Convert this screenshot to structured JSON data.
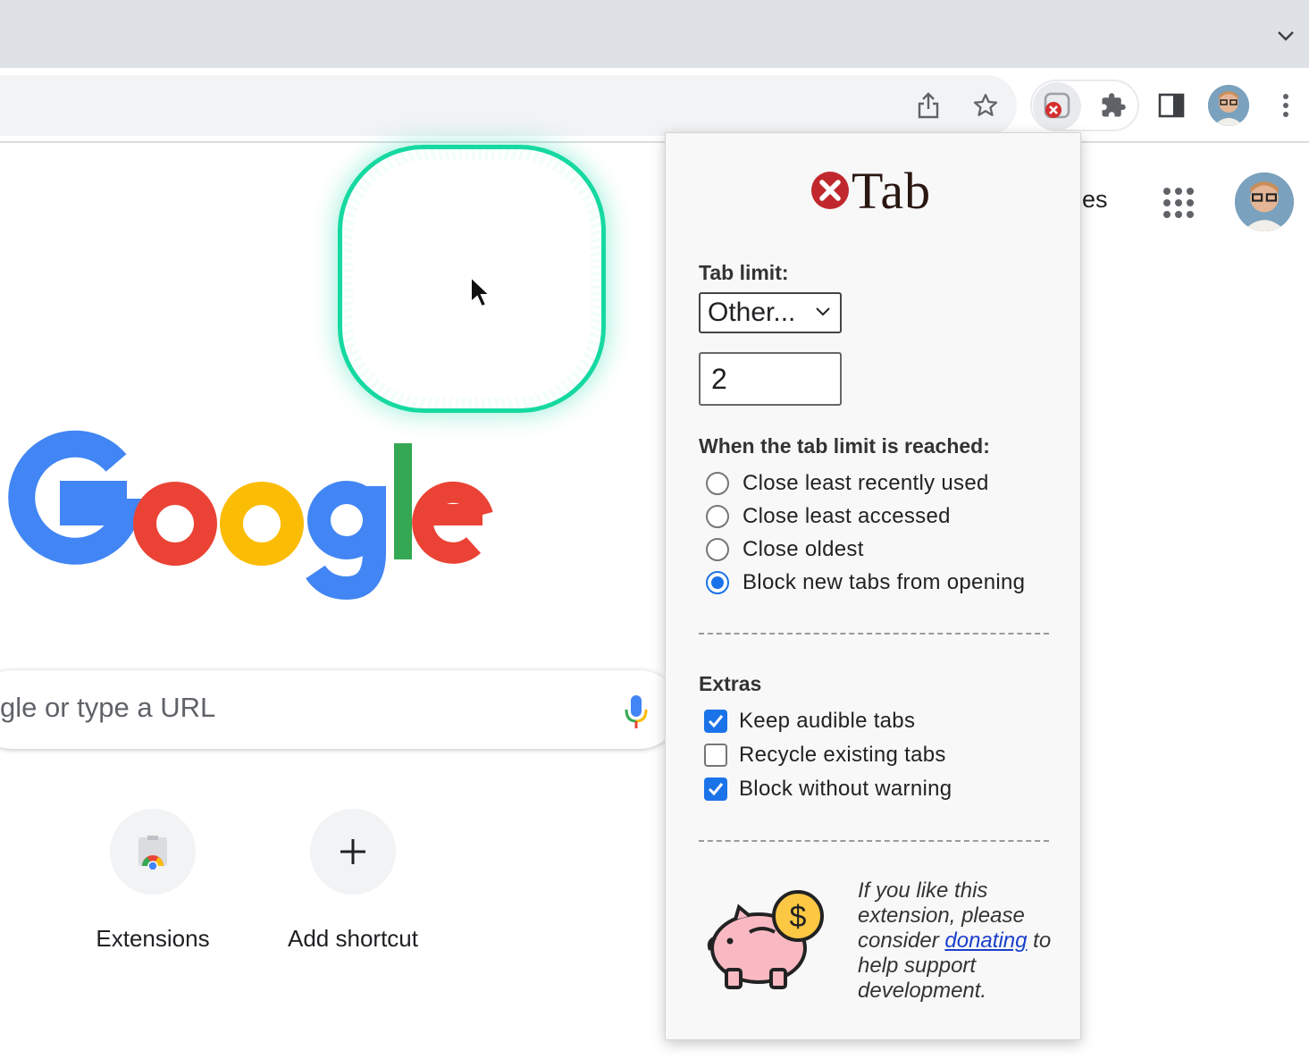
{
  "ntp": {
    "images_link_partial": "ges",
    "search_placeholder_partial": "gle or type a URL",
    "shortcuts": [
      {
        "label": "Extensions"
      },
      {
        "label": "Add shortcut"
      }
    ]
  },
  "popup": {
    "logo_text": "Tab",
    "tab_limit_label": "Tab limit:",
    "tab_limit_select": "Other...",
    "tab_limit_value": "2",
    "when_reached_label": "When the tab limit is reached:",
    "options": [
      {
        "label": "Close least recently used",
        "selected": false
      },
      {
        "label": "Close least accessed",
        "selected": false
      },
      {
        "label": "Close oldest",
        "selected": false
      },
      {
        "label": "Block new tabs from opening",
        "selected": true
      }
    ],
    "extras_label": "Extras",
    "extras": [
      {
        "label": "Keep audible tabs",
        "checked": true
      },
      {
        "label": "Recycle existing tabs",
        "checked": false
      },
      {
        "label": "Block without warning",
        "checked": true
      }
    ],
    "donate": {
      "text_before": "If you like this extension, please consider ",
      "link": "donating",
      "text_after": " to help support development."
    }
  },
  "colors": {
    "accent_blue": "#1a73e8",
    "doodle_green": "#16d9a2",
    "xtab_red": "#c62828"
  }
}
